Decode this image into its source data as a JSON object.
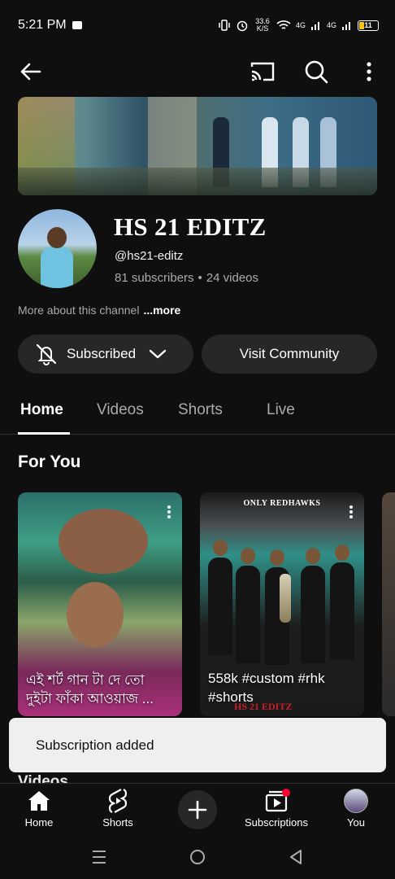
{
  "status_bar": {
    "time": "5:21 PM",
    "net_speed": "33.6 K/S",
    "signal1": "4G",
    "signal2": "4G",
    "battery_level": "11"
  },
  "channel": {
    "name": "HS 21 EDITZ",
    "handle": "@hs21-editz",
    "subscribers": "81 subscribers",
    "separator": "•",
    "videos": "24 videos",
    "about": "More about this channel",
    "about_more": "...more",
    "subscribed_label": "Subscribed",
    "community_label": "Visit Community"
  },
  "tabs": [
    "Home",
    "Videos",
    "Shorts",
    "Live"
  ],
  "section": {
    "title": "For You",
    "behind_label": "Videos"
  },
  "shorts": [
    {
      "caption": "এই শর্ট গান টা দে তো দুইটা ফাঁকা আওয়াজ ..."
    },
    {
      "caption": "558k #custom #rhk #shorts",
      "top_text": "ONLY REDHAWKS",
      "watermark": "HS 21 EDITZ"
    }
  ],
  "snackbar": {
    "message": "Subscription added"
  },
  "bottom_nav": {
    "home": "Home",
    "shorts": "Shorts",
    "subscriptions": "Subscriptions",
    "you": "You"
  },
  "colors": {
    "background": "#0f0f0f",
    "button_bg": "#272727",
    "secondary_text": "#aaaaaa",
    "notification_dot": "#ff0033",
    "snackbar_bg": "#efefef"
  }
}
